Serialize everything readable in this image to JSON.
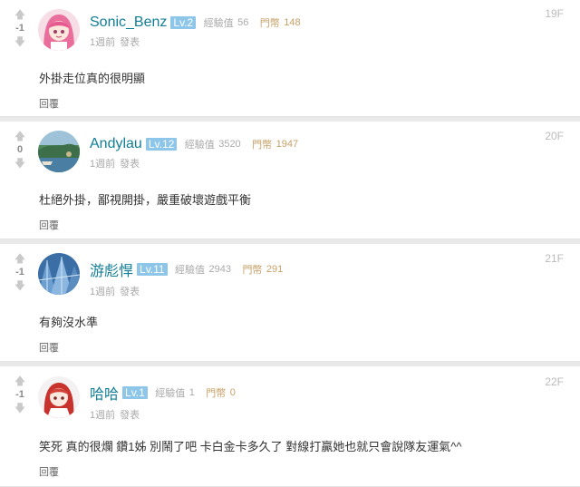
{
  "comments": [
    {
      "score": "-1",
      "username": "Sonic_Benz",
      "level": "Lv.2",
      "exp_label": "經驗值",
      "exp_value": "56",
      "coin_label": "門幣",
      "coin_value": "148",
      "time": "1週前",
      "post_label": "發表",
      "floor": "19F",
      "body": "外掛走位真的很明顯",
      "reply_label": "回覆",
      "avatar_icon": "anime-girl-pink-hair-avatar"
    },
    {
      "score": "0",
      "username": "Andylau",
      "level": "Lv.12",
      "exp_label": "經驗值",
      "exp_value": "3520",
      "coin_label": "門幣",
      "coin_value": "1947",
      "time": "1週前",
      "post_label": "發表",
      "floor": "20F",
      "body": "杜絕外掛，鄙視開掛，嚴重破壞遊戲平衡",
      "reply_label": "回覆",
      "avatar_icon": "landscape-photo-avatar"
    },
    {
      "score": "-1",
      "username": "游彪悍",
      "level": "Lv.11",
      "exp_label": "經驗值",
      "exp_value": "2943",
      "coin_label": "門幣",
      "coin_value": "291",
      "time": "1週前",
      "post_label": "發表",
      "floor": "21F",
      "body": "有夠沒水準",
      "reply_label": "回覆",
      "avatar_icon": "building-glass-avatar"
    },
    {
      "score": "-1",
      "username": "哈哈",
      "level": "Lv.1",
      "exp_label": "經驗值",
      "exp_value": "1",
      "coin_label": "門幣",
      "coin_value": "0",
      "time": "1週前",
      "post_label": "發表",
      "floor": "22F",
      "body": "笑死 真的很爛 鑽1姊 別鬧了吧 卡白金卡多久了 對線打贏她也就只會說隊友運氣^^",
      "reply_label": "回覆",
      "avatar_icon": "anime-girl-red-hair-avatar"
    }
  ],
  "colors": {
    "username": "#117e96",
    "level_badge": "#8ec6ea",
    "coin": "#c7a066",
    "background": "#e9e9e9"
  }
}
